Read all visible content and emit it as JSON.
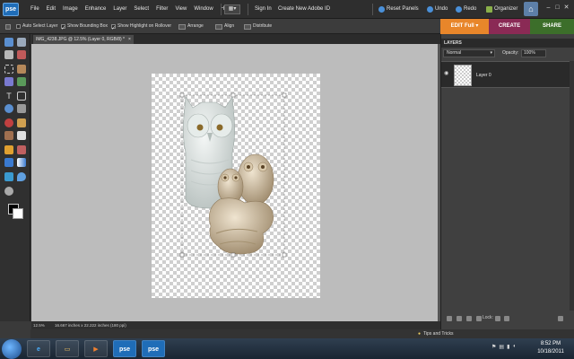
{
  "app": {
    "logo": "pse"
  },
  "menubar": {
    "items": [
      "File",
      "Edit",
      "Image",
      "Enhance",
      "Layer",
      "Select",
      "Filter",
      "View",
      "Window",
      "Help"
    ],
    "sign_in": "Sign In",
    "create_id": "Create New Adobe ID",
    "reset_panels": "Reset Panels",
    "undo": "Undo",
    "redo": "Redo",
    "organizer": "Organizer"
  },
  "options": {
    "auto_select": {
      "label": "Auto Select Layer",
      "checked": false
    },
    "bounding_box": {
      "label": "Show Bounding Box",
      "checked": true
    },
    "highlight": {
      "label": "Show Highlight on Rollover",
      "checked": true
    },
    "arrange": "Arrange",
    "align": "Align",
    "distribute": "Distribute"
  },
  "modes": {
    "edit": "EDIT Full",
    "create": "CREATE",
    "share": "SHARE"
  },
  "document": {
    "tab_title": "IMG_4238.JPG @ 12.5% (Layer 0, RGB/8) *",
    "close": "×"
  },
  "status": {
    "zoom": "12.5%",
    "info": "16.667 inches x 22.222 inches (180 ppi)"
  },
  "layers_panel": {
    "title": "LAYERS",
    "blend_mode": "Normal",
    "opacity_label": "Opacity:",
    "opacity_value": "100%",
    "layers": [
      {
        "name": "Layer 0",
        "visible": true
      }
    ],
    "lock_label": "Lock:"
  },
  "tips": {
    "label": "Tips and Tricks"
  },
  "taskbar": {
    "items": [
      "IE",
      "Explorer",
      "Media",
      "pse",
      "pse"
    ],
    "time": "8:52 PM",
    "date": "10/18/2011"
  }
}
